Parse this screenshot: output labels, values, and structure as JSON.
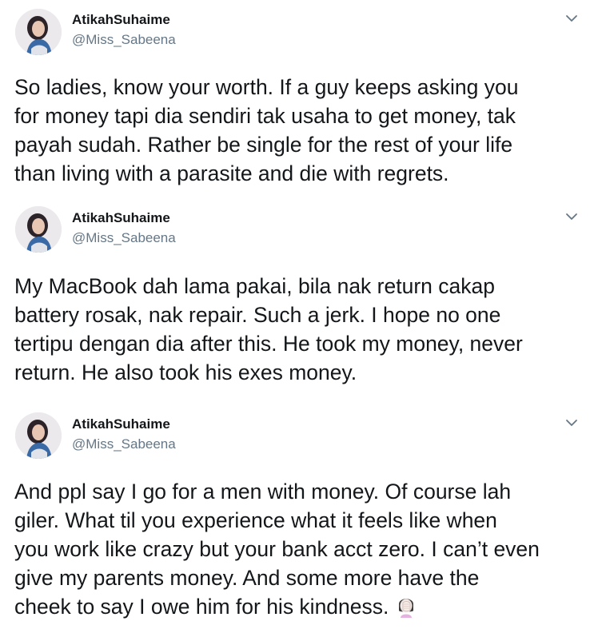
{
  "tweets": [
    {
      "display_name": "AtikahSuhaime",
      "handle": "@Miss_Sabeena",
      "avatar_icon": "profile-avatar",
      "menu_icon": "chevron-down-icon",
      "text": "So ladies, know your worth. If a guy keeps asking you\nfor money tapi dia sendiri tak usaha to get money, tak\npayah sudah. Rather be single for the rest of your life\nthan living with a parasite and die with regrets."
    },
    {
      "display_name": "AtikahSuhaime",
      "handle": "@Miss_Sabeena",
      "avatar_icon": "profile-avatar",
      "menu_icon": "chevron-down-icon",
      "text": "My MacBook dah lama pakai, bila nak return cakap\nbattery rosak, nak repair. Such a jerk. I hope no one\ntertipu dengan dia after this. He took my money, never\nreturn. He also took his exes money."
    },
    {
      "display_name": "AtikahSuhaime",
      "handle": "@Miss_Sabeena",
      "avatar_icon": "profile-avatar",
      "menu_icon": "chevron-down-icon",
      "text": "And ppl say I go for a men with money. Of course lah\ngiler. What til you experience what it feels like when\nyou work like crazy but your bank acct zero. I can’t even\ngive my parents money. And some more have the\ncheek to say I owe him for his kindness.",
      "trailing_emoji": "woman-facepalming-emoji"
    }
  ],
  "colors": {
    "text_primary": "#14171a",
    "text_secondary": "#657786",
    "background": "#ffffff"
  }
}
